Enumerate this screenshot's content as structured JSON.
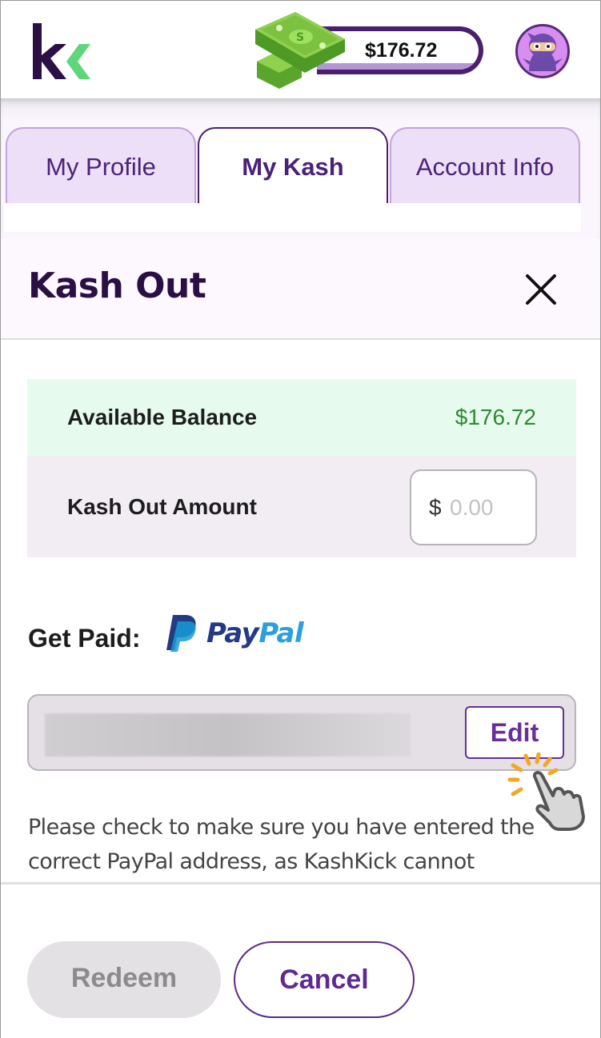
{
  "header": {
    "logo": "kashkick-logo",
    "balance": "$176.72",
    "money_icon": "money-stack-icon",
    "avatar": "ninja-avatar"
  },
  "tabs": [
    {
      "label": "My Profile",
      "active": false
    },
    {
      "label": "My Kash",
      "active": true
    },
    {
      "label": "Account Info",
      "active": false
    }
  ],
  "modal": {
    "title": "Kash Out",
    "close_icon": "close-icon",
    "available_balance_label": "Available Balance",
    "available_balance_value": "$176.72",
    "kash_out_amount_label": "Kash Out Amount",
    "currency_symbol": "$",
    "amount_value": "",
    "amount_placeholder": "0.00",
    "get_paid_label": "Get Paid:",
    "payment_method": {
      "pay": "Pay",
      "pal": "Pal"
    },
    "edit_label": "Edit",
    "notice": "Please check to make sure you have entered the correct PayPal address, as KashKick cannot"
  },
  "footer": {
    "redeem_label": "Redeem",
    "cancel_label": "Cancel"
  },
  "colors": {
    "brand_purple": "#4b1f6f",
    "brand_green": "#5fd67a",
    "balance_green": "#2e8a30",
    "paypal_dark": "#233a86",
    "paypal_light": "#2d9fdc"
  }
}
